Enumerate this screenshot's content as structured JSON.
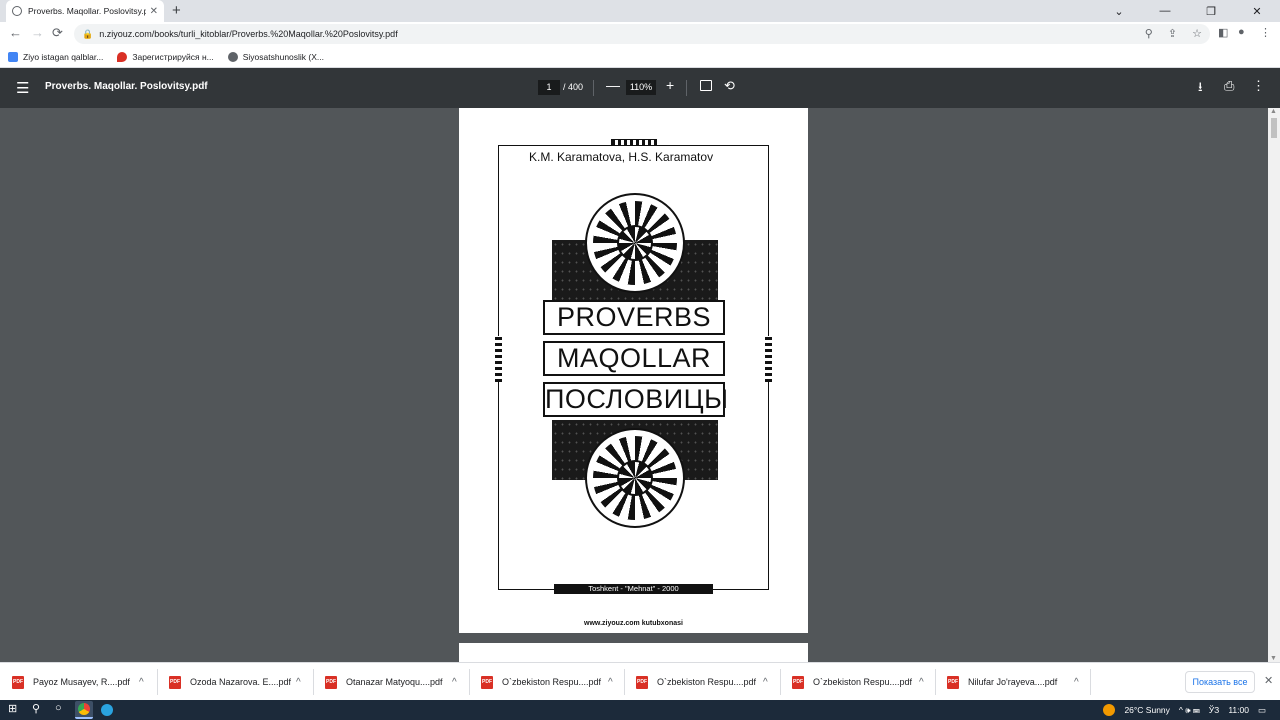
{
  "browser": {
    "tab_title": "Proverbs. Maqollar. Poslovitsy.pdf",
    "tab_close": "✕",
    "new_tab": "+",
    "window_controls": [
      "⌄",
      "—",
      "❐",
      "✕"
    ],
    "url": "n.ziyouz.com/books/turli_kitoblar/Proverbs.%20Maqollar.%20Poslovitsy.pdf",
    "nav": {
      "back": "←",
      "forward": "→",
      "reload": "⟳"
    },
    "omnibox_icons": [
      "⚲",
      "⇪",
      "☆"
    ],
    "toolbar_icons": [
      "◧",
      "●",
      "⋮"
    ]
  },
  "bookmarks": [
    {
      "label": "Ziyo istagan qalblar...",
      "color": "#4285f4"
    },
    {
      "label": "Зарегистрируйся н...",
      "color": "#d93025"
    },
    {
      "label": "Siyosatshunoslik (X...",
      "color": "#5f6368"
    }
  ],
  "pdf_toolbar": {
    "menu_icon": "☰",
    "title": "Proverbs. Maqollar. Poslovitsy.pdf",
    "page_current": "1",
    "page_total": "/ 400",
    "zoom_out": "—",
    "zoom": "110%",
    "zoom_in": "+",
    "rotate": "⟲",
    "download": "⭳",
    "print": "⎙",
    "more": "⋮"
  },
  "document": {
    "authors": "K.M. Karamatova,  H.S. Karamatov",
    "title_lines": [
      "PROVERBS",
      "MAQOLLAR",
      "ПОСЛОВИЦЫ"
    ],
    "publisher": "Toshkent - \"Mehnat\" - 2000",
    "footer": "www.ziyouz.com kutubxonasi"
  },
  "downloads": {
    "items": [
      "Payoz Musayev, R....pdf",
      "Ozoda Nazarova. E....pdf",
      "Otanazar Matyoqu....pdf",
      "O`zbekiston Respu....pdf",
      "O`zbekiston Respu....pdf",
      "O`zbekiston Respu....pdf",
      "Nilufar Jo'rayeva....pdf"
    ],
    "file_badge": "PDF",
    "chevron": "^",
    "show_all": "Показать все",
    "close": "✕"
  },
  "taskbar": {
    "start": "⊞",
    "search": "⚲",
    "task_view": "○",
    "weather": "26°C  Sunny",
    "tray_icons": "^  🕪  ⌨",
    "lang": "ЎЗ",
    "time": "11:00",
    "notifications": "▭"
  }
}
